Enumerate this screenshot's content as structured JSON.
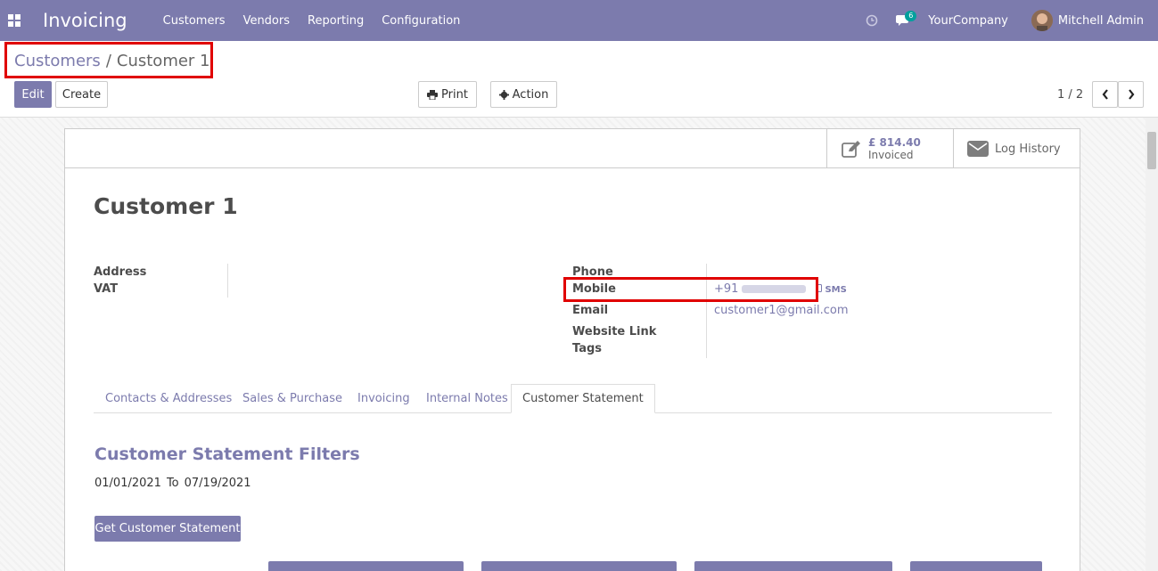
{
  "navbar": {
    "app_title": "Invoicing",
    "menu": [
      "Customers",
      "Vendors",
      "Reporting",
      "Configuration"
    ],
    "chat_badge": "6",
    "company": "YourCompany",
    "user": "Mitchell Admin",
    "bg_color": "#7c7bad"
  },
  "breadcrumb": {
    "parent": "Customers",
    "separator": "/",
    "current": "Customer 1"
  },
  "toolbar": {
    "edit_label": "Edit",
    "create_label": "Create",
    "print_label": "Print",
    "action_label": "Action",
    "pager": "1 / 2"
  },
  "stat_buttons": {
    "invoiced_value": "£ 814.40",
    "invoiced_label": "Invoiced",
    "log_label": "Log History"
  },
  "record": {
    "title": "Customer 1",
    "left_fields": {
      "address": "Address",
      "vat": "VAT"
    },
    "right_fields": {
      "phone": "Phone",
      "mobile": "Mobile",
      "email": "Email",
      "website": "Website Link",
      "tags": "Tags"
    },
    "mobile_prefix": "+91",
    "sms_label": "SMS",
    "email_value": "customer1@gmail.com"
  },
  "tabs": [
    {
      "label": "Contacts & Addresses",
      "active": false
    },
    {
      "label": "Sales & Purchase",
      "active": false
    },
    {
      "label": "Invoicing",
      "active": false
    },
    {
      "label": "Internal Notes",
      "active": false
    },
    {
      "label": "Customer Statement",
      "active": true
    }
  ],
  "statement": {
    "title": "Customer Statement Filters",
    "date_from": "01/01/2021",
    "to_label": "To",
    "date_to": "07/19/2021",
    "get_button": "Get Customer Statement"
  },
  "colors": {
    "accent": "#7c7bad",
    "highlight": "#e00000",
    "badge": "#00a09d"
  }
}
